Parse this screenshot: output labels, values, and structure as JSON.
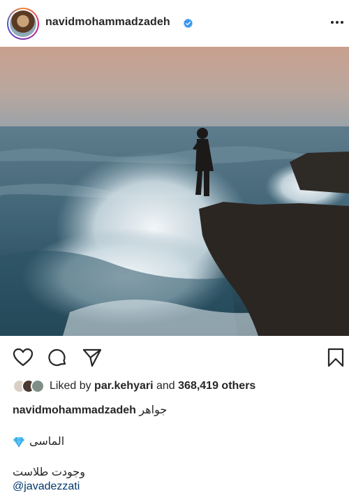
{
  "header": {
    "username": "navidmohammadzadeh",
    "verified_color": "#3897f0",
    "avatar_icon": "profile-avatar",
    "more_icon": "more-horizontal-icon"
  },
  "post": {
    "image_icon": "post-photo-sea-wave-man-on-rocks"
  },
  "actions": {
    "like_icon": "heart-icon",
    "comment_icon": "comment-icon",
    "share_icon": "send-icon",
    "save_icon": "bookmark-icon"
  },
  "likes": {
    "prefix": "Liked by ",
    "liker": "par.kehyari",
    "connector": " and ",
    "others": "368,419 others"
  },
  "caption": {
    "username": "navidmohammadzadeh",
    "text": "جواهر",
    "line2": "الماسی",
    "line3": "وجودت طلاست",
    "mention": "@javadezzati"
  },
  "colors": {
    "text": "#262626",
    "link": "#00376b",
    "accent": "#3897f0"
  }
}
